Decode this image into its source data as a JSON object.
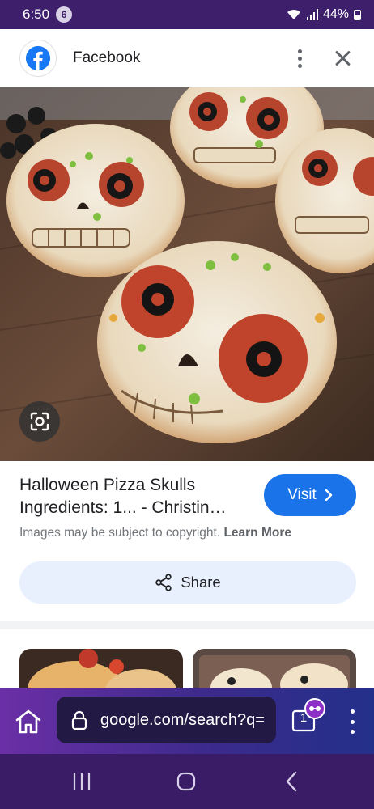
{
  "status_bar": {
    "time": "6:50",
    "notification_count": "6",
    "battery": "44%",
    "icons": [
      "wifi-icon",
      "signal-icon",
      "battery-icon"
    ]
  },
  "header": {
    "source_name": "Facebook",
    "icons": [
      "facebook-logo",
      "more-vert-icon",
      "close-icon"
    ]
  },
  "image": {
    "subject": "Pizza skulls"
  },
  "result": {
    "title_line1": "Halloween Pizza Skulls",
    "title_line2": "Ingredients: 1... - Christin…",
    "visit_label": "Visit",
    "copyright_text": "Images may be subject to copyright.",
    "learn_more_label": "Learn More",
    "share_label": "Share"
  },
  "browser": {
    "url": "google.com/search?q=",
    "tab_count": "1",
    "icons": [
      "home-icon",
      "lock-icon",
      "tabs-icon",
      "incognito-icon",
      "more-vert-icon"
    ]
  },
  "nav": {
    "icons": [
      "recent-apps-icon",
      "home-button-icon",
      "back-icon"
    ]
  },
  "colors": {
    "status_bar": "#3d1f6b",
    "accent_blue": "#1a73e8",
    "share_bg": "#e8f0fe",
    "nav_bar": "#3a1c66"
  }
}
